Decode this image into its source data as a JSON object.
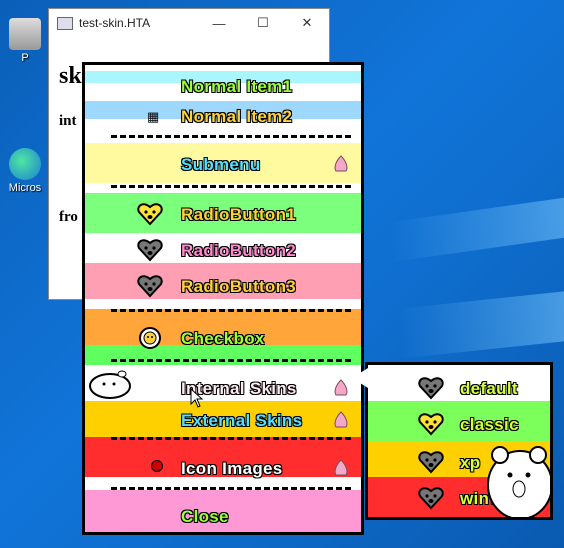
{
  "desktop": {
    "icons": [
      {
        "label": "P"
      },
      {
        "label": "Micros"
      }
    ]
  },
  "window": {
    "title": "test-skin.HTA",
    "controls": {
      "minimize": "—",
      "maximize": "☐",
      "close": "✕"
    },
    "body_lines": [
      "sk",
      "int",
      "fro"
    ]
  },
  "menu": {
    "items": [
      {
        "label": "Normal Item1",
        "color": "#9cff3a",
        "icon": "none"
      },
      {
        "label": "Normal Item2",
        "color": "#ffd23a",
        "icon": "windows-logo-icon"
      },
      {
        "label": "Submenu",
        "color": "#56e0ff",
        "icon": "none",
        "submenu": true
      },
      {
        "label": "RadioButton1",
        "color": "#ffd23a",
        "icon": "heart-face-yellow-icon"
      },
      {
        "label": "RadioButton2",
        "color": "#ff8ad0",
        "icon": "heart-face-gray-icon"
      },
      {
        "label": "RadioButton3",
        "color": "#ffd23a",
        "icon": "heart-face-gray-icon"
      },
      {
        "label": "Checkbox",
        "color": "#9cff3a",
        "icon": "flower-face-icon"
      },
      {
        "label": "Internal Skins",
        "color": "#ffe9f3",
        "icon": "none",
        "submenu": true,
        "highlighted": true
      },
      {
        "label": "External Skins",
        "color": "#56e0ff",
        "icon": "none",
        "submenu": true
      },
      {
        "label": "Icon Images",
        "color": "#ffffff",
        "icon": "small-red-icon",
        "submenu": true
      },
      {
        "label": "Close",
        "color": "#9cff3a",
        "icon": "none"
      }
    ]
  },
  "submenu": {
    "items": [
      {
        "label": "default",
        "icon": "heart-face-gray-icon"
      },
      {
        "label": "classic",
        "icon": "heart-face-yellow-icon"
      },
      {
        "label": "xp",
        "icon": "heart-face-gray-icon"
      },
      {
        "label": "win7",
        "icon": "heart-face-gray-icon"
      }
    ]
  }
}
